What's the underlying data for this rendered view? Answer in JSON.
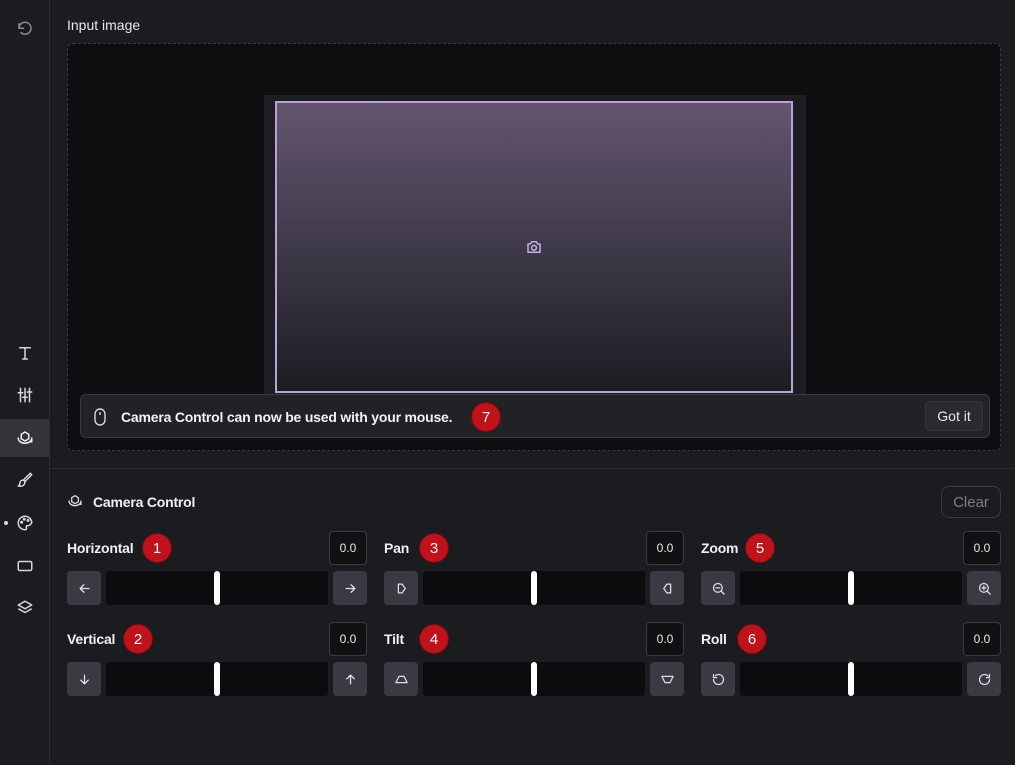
{
  "sidebar": {
    "items": [
      {
        "icon": "undo-icon"
      },
      {
        "icon": "text-icon"
      },
      {
        "icon": "sliders-icon"
      },
      {
        "icon": "camera-control-icon",
        "active": true
      },
      {
        "icon": "brush-icon"
      },
      {
        "icon": "palette-icon"
      },
      {
        "icon": "aspect-ratio-icon"
      },
      {
        "icon": "layers-icon"
      }
    ]
  },
  "input_image": {
    "title": "Input image",
    "notice": {
      "text": "Camera Control can now be used with your mouse.",
      "button": "Got it",
      "badge": "7"
    }
  },
  "camera_control": {
    "title": "Camera Control",
    "clear_label": "Clear",
    "controls": [
      {
        "id": "horizontal",
        "label": "Horizontal",
        "value": "0.0",
        "badge": "1",
        "position": 0.5,
        "left_icon": "arrow-left-icon",
        "right_icon": "arrow-right-icon"
      },
      {
        "id": "vertical",
        "label": "Vertical",
        "value": "0.0",
        "badge": "2",
        "position": 0.5,
        "left_icon": "arrow-down-icon",
        "right_icon": "arrow-up-icon"
      },
      {
        "id": "pan",
        "label": "Pan",
        "value": "0.0",
        "badge": "3",
        "position": 0.5,
        "left_icon": "pan-left-icon",
        "right_icon": "pan-right-icon"
      },
      {
        "id": "tilt",
        "label": "Tilt",
        "value": "0.0",
        "badge": "4",
        "position": 0.5,
        "left_icon": "tilt-up-icon",
        "right_icon": "tilt-down-icon"
      },
      {
        "id": "zoom",
        "label": "Zoom",
        "value": "0.0",
        "badge": "5",
        "position": 0.5,
        "left_icon": "zoom-out-icon",
        "right_icon": "zoom-in-icon"
      },
      {
        "id": "roll",
        "label": "Roll",
        "value": "0.0",
        "badge": "6",
        "position": 0.5,
        "left_icon": "rotate-left-icon",
        "right_icon": "rotate-right-icon"
      }
    ]
  },
  "colors": {
    "background": "#1b1c20",
    "frame_border": "#b7a3d9",
    "badge": "#c0121a",
    "button": "#3a3b42"
  }
}
